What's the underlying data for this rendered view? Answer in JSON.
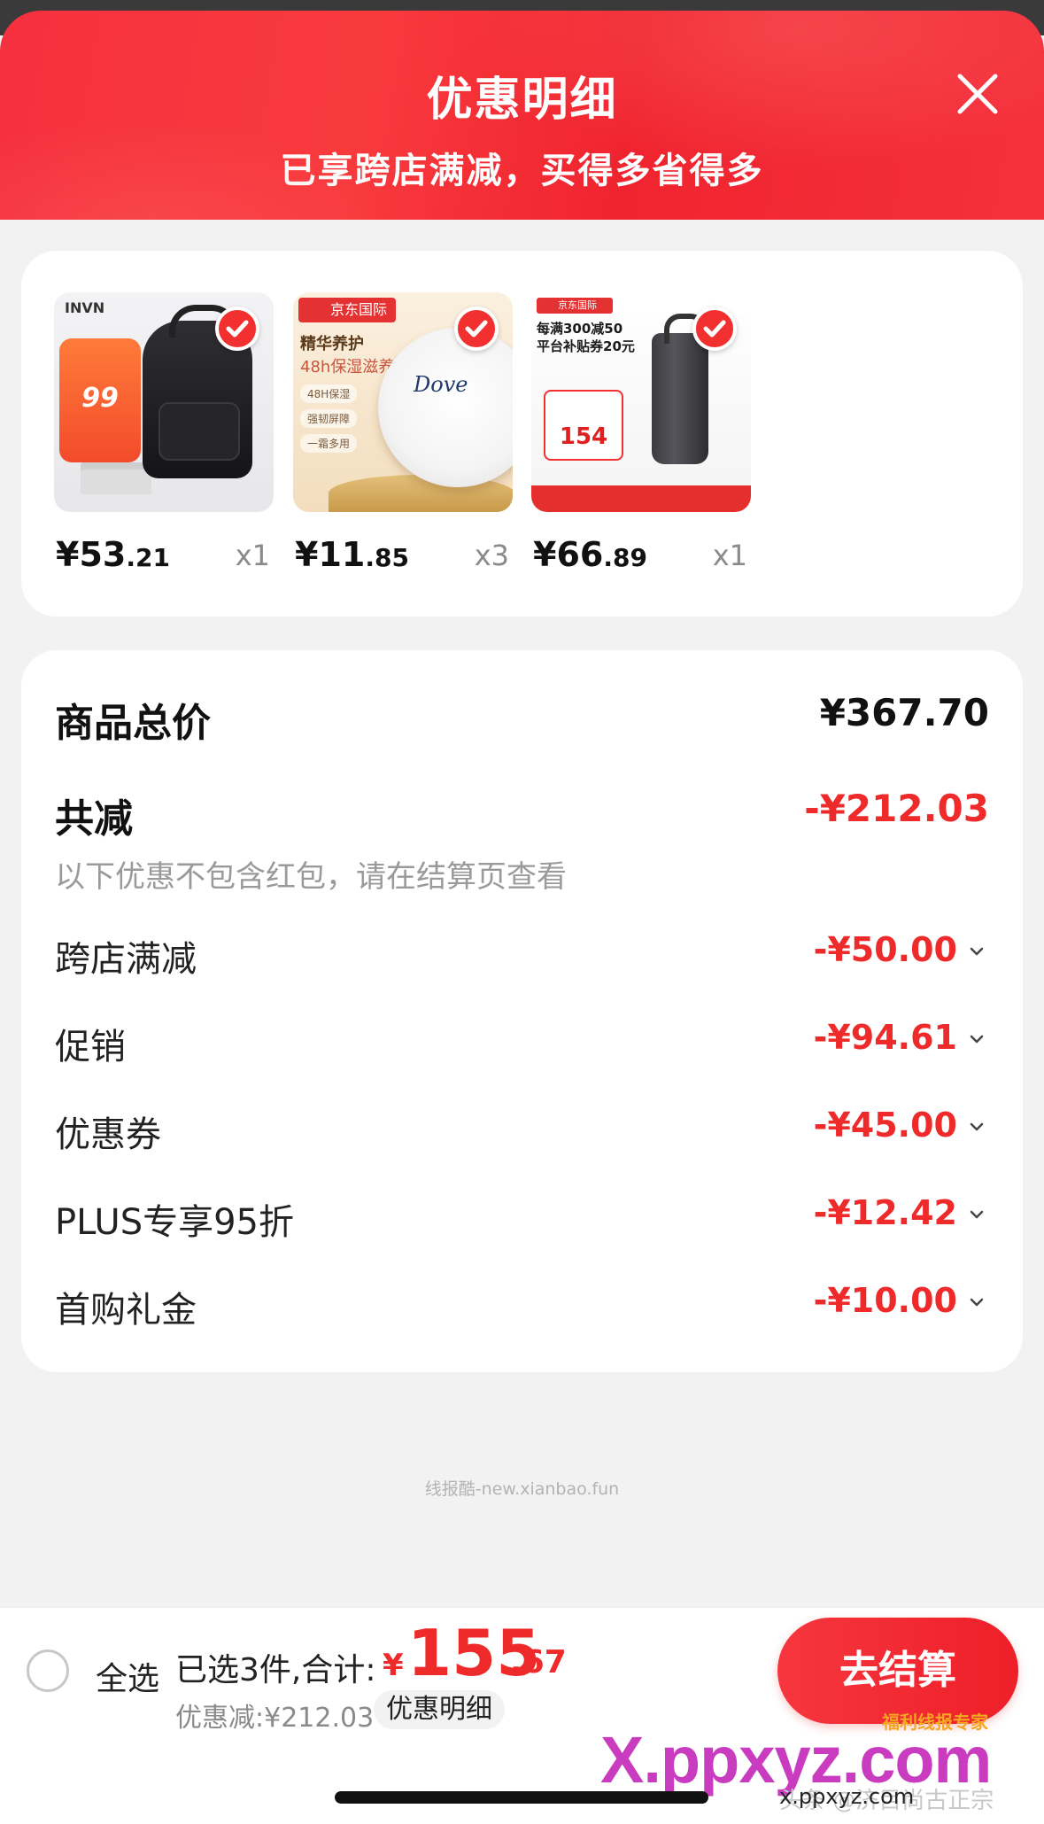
{
  "header": {
    "title": "优惠明细",
    "subtitle": "已享跨店满减，买得多省得多",
    "close_icon": "close-icon"
  },
  "products": [
    {
      "name": "backpack",
      "img_brand": "INVN",
      "img_tag": "99",
      "price_int": "¥53",
      "price_dec": ".21",
      "qty": "x1",
      "selected": true
    },
    {
      "name": "dove-body-cream",
      "img_badge": "京东国际",
      "img_line1": "精华养护",
      "img_line2": "48h保湿滋养",
      "img_pill1": "48H保湿",
      "img_pill2": "强韧屏障",
      "img_pill3": "一霜多用",
      "img_brand": "Dove",
      "price_int": "¥11",
      "price_dec": ".85",
      "qty": "x3",
      "selected": true
    },
    {
      "name": "thermos-mug",
      "img_badge": "京东国际",
      "img_line1": "每满300减50",
      "img_line2": "平台补贴券20元",
      "img_price": "154",
      "price_int": "¥66",
      "price_dec": ".89",
      "qty": "x1",
      "selected": true
    }
  ],
  "summary": {
    "total_label": "商品总价",
    "total_value": "¥367.70",
    "reduce_label": "共减",
    "reduce_value": "-¥212.03",
    "note": "以下优惠不包含红包，请在结算页查看",
    "items": [
      {
        "label": "跨店满减",
        "value": "-¥50.00"
      },
      {
        "label": "促销",
        "value": "-¥94.61"
      },
      {
        "label": "优惠券",
        "value": "-¥45.00"
      },
      {
        "label": "PLUS专享95折",
        "value": "-¥12.42"
      },
      {
        "label": "首购礼金",
        "value": "-¥10.00"
      }
    ]
  },
  "watermark": "线报酷-new.xianbao.fun",
  "bottom_bar": {
    "select_all": "全选",
    "selected_text": "已选3件,合计:",
    "currency": "¥",
    "total_int": "155",
    "total_dec": ".67",
    "discount_text": "优惠减:¥212.03",
    "detail_link": "优惠明细",
    "checkout": "去结算"
  },
  "logos": {
    "small": "福利线报专家",
    "big": "X.ppxyz.com",
    "caption": "x.ppxyz.com",
    "faint": "头条 @济目尚古正宗"
  },
  "colors": {
    "accent_red": "#ee2a2a",
    "header_red": "#f5303f"
  }
}
